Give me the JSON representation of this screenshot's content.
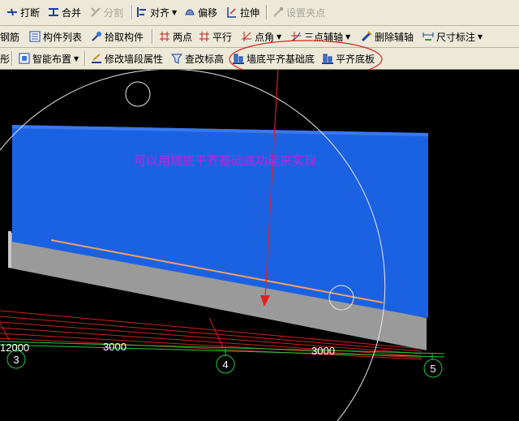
{
  "toolbar_row1": [
    {
      "label": "打断",
      "icon": "break-icon"
    },
    {
      "label": "合并",
      "icon": "merge-icon"
    },
    {
      "label": "分割",
      "icon": "split-icon",
      "disabled": true
    },
    {
      "label": "对齐",
      "icon": "align-icon",
      "dropdown": true
    },
    {
      "label": "偏移",
      "icon": "offset-icon"
    },
    {
      "label": "拉伸",
      "icon": "stretch-icon"
    },
    {
      "label": "设置夹点",
      "icon": "grip-point-icon",
      "disabled": true
    }
  ],
  "toolbar_row2": [
    {
      "label": "钢筋"
    },
    {
      "label": "构件列表",
      "icon": "component-list-icon"
    },
    {
      "label": "拾取构件",
      "icon": "pick-component-icon"
    },
    {
      "label": "两点",
      "icon": "two-point-icon"
    },
    {
      "label": "平行",
      "icon": "parallel-icon"
    },
    {
      "label": "点角",
      "icon": "point-angle-icon",
      "dropdown": true
    },
    {
      "label": "三点辅轴",
      "icon": "three-point-axis-icon",
      "dropdown": true
    },
    {
      "label": "删除辅轴",
      "icon": "delete-axis-icon"
    },
    {
      "label": "尺寸标注",
      "icon": "dimension-icon",
      "dropdown": true
    }
  ],
  "toolbar_row3": [
    {
      "label": "彤"
    },
    {
      "label": "智能布置",
      "icon": "smart-layout-icon",
      "dropdown": true
    },
    {
      "label": "修改墙段属性",
      "icon": "edit-wall-segment-icon"
    },
    {
      "label": "查改标高",
      "icon": "check-elevation-icon"
    },
    {
      "label": "墙底平齐基础底",
      "icon": "wall-bottom-align-foundation-icon"
    },
    {
      "label": "平齐底板",
      "icon": "align-slab-bottom-icon"
    }
  ],
  "annotation": "可以用墙底平齐基础底功能来实现",
  "axes": {
    "labels": [
      "3",
      "4",
      "5"
    ],
    "dimensions": [
      "12000",
      "3000",
      "3000"
    ]
  },
  "colors": {
    "wall": "#1b62e3",
    "foundation": "#9a9a9a",
    "annotation": "#c020e0",
    "callout": "#e02020",
    "axis": "#24c83a"
  }
}
